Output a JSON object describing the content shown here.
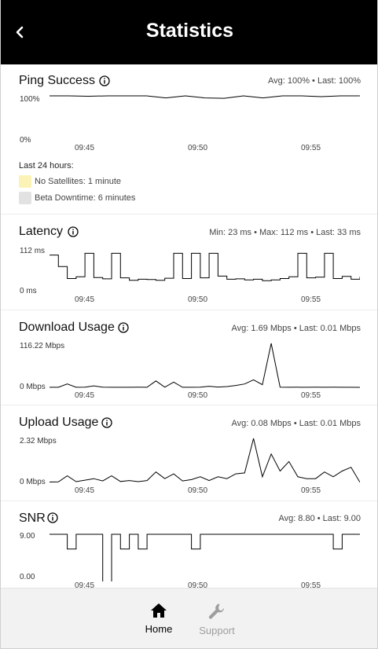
{
  "header": {
    "title": "Statistics",
    "back_icon": "chevron-left-icon"
  },
  "cards": {
    "ping": {
      "title": "Ping Success",
      "stats": "Avg: 100% • Last: 100%",
      "y_max": "100%",
      "y_min": "0%",
      "x_ticks": [
        "09:45",
        "09:50",
        "09:55"
      ],
      "legend_title": "Last 24 hours:",
      "legend_items": [
        {
          "label": "No Satellites: 1 minute",
          "color": "#fbf3b6"
        },
        {
          "label": "Beta Downtime: 6 minutes",
          "color": "#e2e2e2"
        }
      ]
    },
    "latency": {
      "title": "Latency",
      "stats": "Min: 23 ms • Max: 112 ms • Last: 33 ms",
      "y_max": "112 ms",
      "y_min": "0 ms",
      "x_ticks": [
        "09:45",
        "09:50",
        "09:55"
      ]
    },
    "download": {
      "title": "Download Usage",
      "stats": "Avg: 1.69 Mbps • Last: 0.01 Mbps",
      "y_max": "116.22 Mbps",
      "y_min": "0 Mbps",
      "x_ticks": [
        "09:45",
        "09:50",
        "09:55"
      ]
    },
    "upload": {
      "title": "Upload Usage",
      "stats": "Avg: 0.08 Mbps • Last: 0.01 Mbps",
      "y_max": "2.32 Mbps",
      "y_min": "0 Mbps",
      "x_ticks": [
        "09:45",
        "09:50",
        "09:55"
      ]
    },
    "snr": {
      "title": "SNR",
      "stats": "Avg: 8.80 • Last: 9.00",
      "y_max": "9.00",
      "y_min": "0.00",
      "x_ticks": [
        "09:45",
        "09:50",
        "09:55"
      ]
    }
  },
  "footer": {
    "home": {
      "label": "Home",
      "icon": "home-icon"
    },
    "support": {
      "label": "Support",
      "icon": "wrench-icon"
    }
  },
  "chart_data": [
    {
      "type": "line",
      "name": "ping",
      "x": [
        "09:42",
        "09:43",
        "09:44",
        "09:45",
        "09:46",
        "09:47",
        "09:48",
        "09:49",
        "09:50",
        "09:51",
        "09:52",
        "09:53",
        "09:54",
        "09:55",
        "09:56",
        "09:57",
        "09:58"
      ],
      "ylim": [
        0,
        100
      ],
      "values": [
        100,
        100,
        99,
        100,
        100,
        100,
        95,
        100,
        95,
        94,
        100,
        95,
        100,
        100,
        98,
        100,
        100
      ]
    },
    {
      "type": "line",
      "name": "latency",
      "ylim": [
        0,
        112
      ],
      "x": [
        "09:42",
        "09:43",
        "09:44",
        "09:45",
        "09:46",
        "09:47",
        "09:48",
        "09:49",
        "09:50",
        "09:51",
        "09:52",
        "09:53",
        "09:54",
        "09:55",
        "09:56",
        "09:57",
        "09:58"
      ],
      "values": [
        95,
        62,
        28,
        33,
        100,
        31,
        27,
        100,
        30,
        23,
        26,
        25,
        23,
        29,
        100,
        28,
        100,
        30,
        100,
        35,
        26,
        27,
        24,
        26,
        22,
        24,
        28,
        33,
        100,
        30,
        32,
        100,
        28,
        34,
        26,
        33
      ]
    },
    {
      "type": "line",
      "name": "download",
      "ylim": [
        0,
        116.22
      ],
      "values": [
        0.2,
        0.2,
        9,
        0.3,
        0.5,
        4,
        0.5,
        0.2,
        0.3,
        0.2,
        0.4,
        0.3,
        17,
        0.4,
        14,
        0.3,
        0.2,
        0.5,
        3,
        0.8,
        2,
        5,
        9,
        20,
        7,
        116.22,
        0.6,
        0.3,
        0.5,
        0.2,
        0.4,
        0.3,
        0.5,
        0.2,
        0.3,
        0.01
      ]
    },
    {
      "type": "line",
      "name": "upload",
      "ylim": [
        0,
        2.32
      ],
      "values": [
        0.02,
        0.03,
        0.35,
        0.04,
        0.12,
        0.2,
        0.08,
        0.35,
        0.05,
        0.1,
        0.04,
        0.1,
        0.55,
        0.2,
        0.45,
        0.08,
        0.15,
        0.3,
        0.1,
        0.3,
        0.2,
        0.45,
        0.5,
        2.32,
        0.3,
        1.5,
        0.6,
        1.1,
        0.3,
        0.2,
        0.2,
        0.55,
        0.3,
        0.6,
        0.8,
        0.01
      ]
    },
    {
      "type": "line",
      "name": "snr",
      "ylim": [
        0,
        9
      ],
      "values": [
        9,
        9,
        6,
        9,
        9,
        9,
        -1,
        9,
        6,
        9,
        6,
        9,
        9,
        9,
        9,
        9,
        6,
        9,
        9,
        9,
        9,
        9,
        9,
        9,
        9,
        9,
        9,
        9,
        9,
        9,
        9,
        9,
        6,
        9,
        9,
        9
      ]
    }
  ]
}
